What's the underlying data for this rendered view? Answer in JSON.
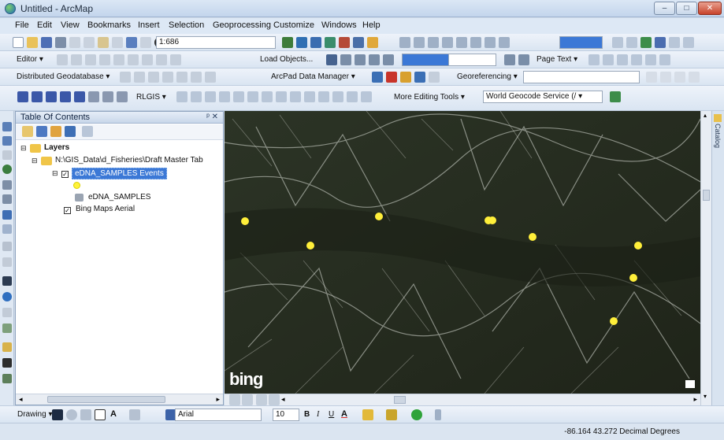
{
  "window": {
    "title": "Untitled - ArcMap",
    "min": "–",
    "max": "□",
    "close": "✕"
  },
  "menu": [
    "File",
    "Edit",
    "View",
    "Bookmarks",
    "Insert",
    "Selection",
    "Geoprocessing",
    "Customize",
    "Windows",
    "Help"
  ],
  "toolbar1": {
    "scale": "1:686"
  },
  "toolbar2": {
    "editor": "Editor ▾",
    "load_objects": "Load Objects...",
    "page_text": "Page Text ▾"
  },
  "toolbar3": {
    "distributed": "Distributed Geodatabase ▾",
    "arcpad": "ArcPad Data Manager ▾",
    "georef": "Georeferencing ▾"
  },
  "toolbar4": {
    "rlgis": "RLGIS ▾",
    "more_editing": "More Editing Tools ▾",
    "geocode": "World Geocode Service (/ ▾"
  },
  "toc": {
    "title": "Table Of Contents",
    "pin": "ᵖ ✕",
    "layers_label": "Layers",
    "group": "N:\\GIS_Data\\d_Fisheries\\Draft Master Tab",
    "events_layer": "eDNA_SAMPLES Events",
    "samples_layer": "eDNA_SAMPLES",
    "bing_layer": "Bing Maps Aerial"
  },
  "map": {
    "watermark": "bing",
    "point_color": "#ffef3a",
    "points_note": "sample points drawn by script"
  },
  "drawing": {
    "label": "Drawing ▾",
    "font": "Arial",
    "size": "10",
    "bold": "B",
    "italic": "I",
    "underline": "U",
    "text_a": "A"
  },
  "status": {
    "coords": "-86.164  43.272 Decimal Degrees"
  },
  "catalog_tab": "Catalog",
  "colors": {
    "accent": "#3b78d6",
    "map_bg": "#2a2f24"
  }
}
